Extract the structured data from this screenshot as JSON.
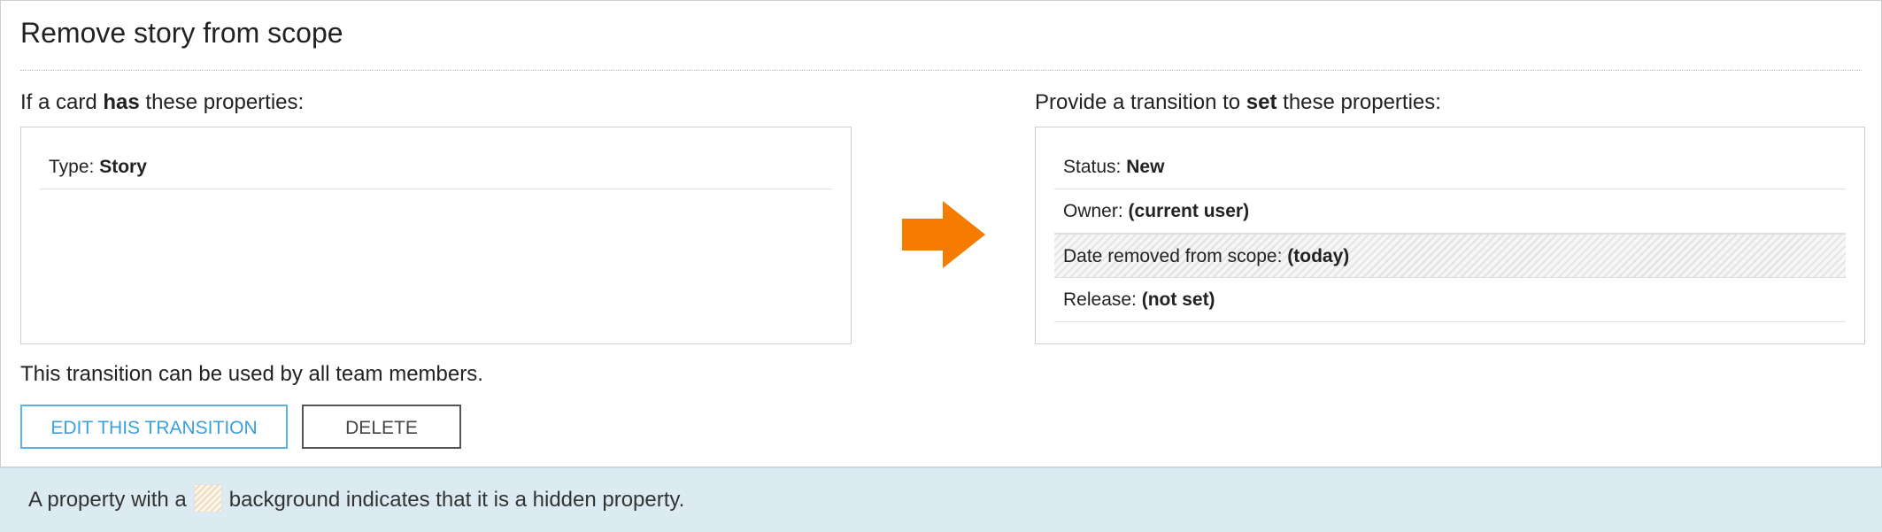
{
  "title": "Remove story from scope",
  "conditions": {
    "label_prefix": "If a card ",
    "label_bold": "has",
    "label_suffix": " these properties:",
    "properties": [
      {
        "name": "Type:",
        "value": "Story",
        "hidden": false
      }
    ]
  },
  "transition_icon": "right-arrow-icon",
  "actions": {
    "label_prefix": "Provide a transition to ",
    "label_bold": "set",
    "label_suffix": " these properties:",
    "properties": [
      {
        "name": "Status:",
        "value": "New",
        "hidden": false
      },
      {
        "name": "Owner:",
        "value": "(current user)",
        "hidden": false
      },
      {
        "name": "Date removed from scope:",
        "value": "(today)",
        "hidden": true
      },
      {
        "name": "Release:",
        "value": "(not set)",
        "hidden": false
      }
    ]
  },
  "usage_text": "This transition can be used by all team members.",
  "buttons": {
    "edit": "EDIT THIS TRANSITION",
    "delete": "DELETE"
  },
  "footer": {
    "text_before": "A property with a",
    "text_after": "background indicates that it is a hidden property."
  },
  "colors": {
    "accent": "#3aa0dc",
    "arrow": "#f57c00",
    "footer_bg": "#dcebf2"
  }
}
